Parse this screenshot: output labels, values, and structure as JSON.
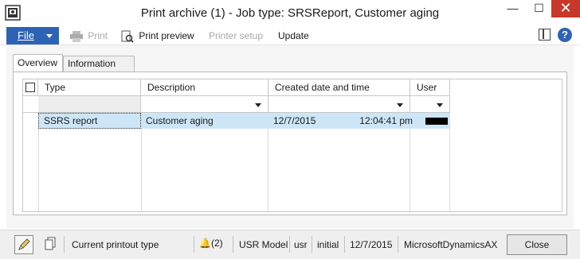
{
  "window": {
    "title": "Print archive (1) - Job type: SRSReport, Customer aging",
    "minimize": "—",
    "maximize": "☐",
    "close": "✕"
  },
  "toolbar": {
    "file_label": "File",
    "print_label": "Print",
    "print_preview_label": "Print preview",
    "printer_setup_label": "Printer setup",
    "update_label": "Update",
    "help_label": "?"
  },
  "tabs": [
    {
      "label": "Overview",
      "selected": true
    },
    {
      "label": "Information",
      "selected": false
    }
  ],
  "grid": {
    "columns": [
      "Type",
      "Description",
      "Created date and time",
      "User"
    ],
    "rows": [
      {
        "type": "SSRS report",
        "description": "Customer aging",
        "date": "12/7/2015",
        "time": "12:04:41 pm",
        "user": "[redacted]"
      }
    ]
  },
  "statusbar": {
    "current_printout": "Current printout type",
    "notifications": "(2)",
    "model": "USR Model",
    "layer": "usr",
    "company": "initial",
    "date": "12/7/2015",
    "instance": "MicrosoftDynamicsAX",
    "close_label": "Close"
  },
  "colors": {
    "accent": "#2d63b5",
    "selected_row": "#cde6f7",
    "close_red": "#c7372a"
  }
}
